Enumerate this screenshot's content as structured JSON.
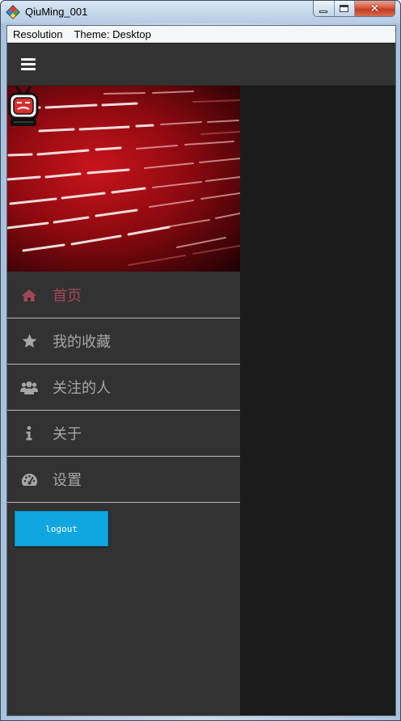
{
  "window": {
    "title": "QiuMing_001",
    "controls": [
      "minimize",
      "maximize",
      "close"
    ]
  },
  "menubar": {
    "items": [
      "Resolution",
      "Theme: Desktop"
    ]
  },
  "appbar": {
    "menu_icon": "hamburger-menu-icon"
  },
  "drawer": {
    "banner_icon": "tv-mascot-avatar",
    "nav": [
      {
        "label": "首页",
        "icon": "home-icon",
        "active": true
      },
      {
        "label": "我的收藏",
        "icon": "star-icon",
        "active": false
      },
      {
        "label": "关注的人",
        "icon": "users-icon",
        "active": false
      },
      {
        "label": "关于",
        "icon": "info-icon",
        "active": false
      },
      {
        "label": "设置",
        "icon": "dashboard-icon",
        "active": false
      }
    ],
    "logout_label": "logout"
  },
  "colors": {
    "accent_active": "#a4465c",
    "nav_text": "#a6a6a6",
    "drawer_bg": "#323232",
    "content_bg": "#1b1b1b",
    "logout_bg": "#10a6e0"
  }
}
